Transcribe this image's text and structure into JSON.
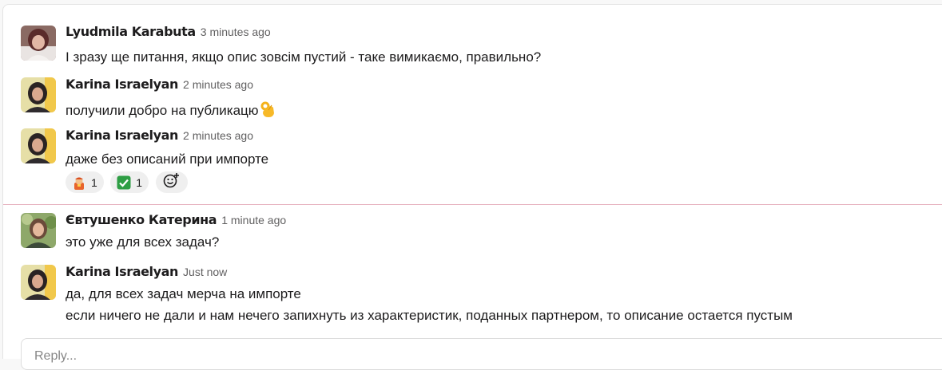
{
  "messages": [
    {
      "author": "Lyudmila Karabuta",
      "time": "3 minutes ago",
      "lines": [
        "І зразу ще питання,  якщо опис зовсім пустий - таке вимикаємо, правильно?"
      ]
    },
    {
      "author": "Karina Israelyan",
      "time": "2 minutes ago",
      "lines": [
        "получили добро на публикацю"
      ],
      "trailing_emoji": "ok-hand-icon"
    },
    {
      "author": "Karina Israelyan",
      "time": "2 minutes ago",
      "lines": [
        "даже без описаний при импорте"
      ],
      "reactions": [
        {
          "emoji": "mechanic-icon",
          "count": "1"
        },
        {
          "emoji": "check-mark-icon",
          "count": "1"
        }
      ],
      "add_reaction_icon": "add-reaction-icon"
    },
    {
      "author": "Євтушенко Катерина",
      "time": "1 minute ago",
      "lines": [
        "это уже для всех задач?"
      ]
    },
    {
      "author": "Karina Israelyan",
      "time": "Just now",
      "lines": [
        "да, для всех задач мерча на импорте",
        "если ничего не дали и нам нечего запихнуть из характеристик, поданных партнером, то описание остается пустым"
      ]
    }
  ],
  "new_messages_divider_color": "#e7b4c0",
  "composer": {
    "placeholder": "Reply..."
  },
  "colors": {
    "text": "#1d1c1d",
    "muted": "#616061",
    "reaction_bg": "#efefef",
    "check_green": "#2e9e44"
  }
}
